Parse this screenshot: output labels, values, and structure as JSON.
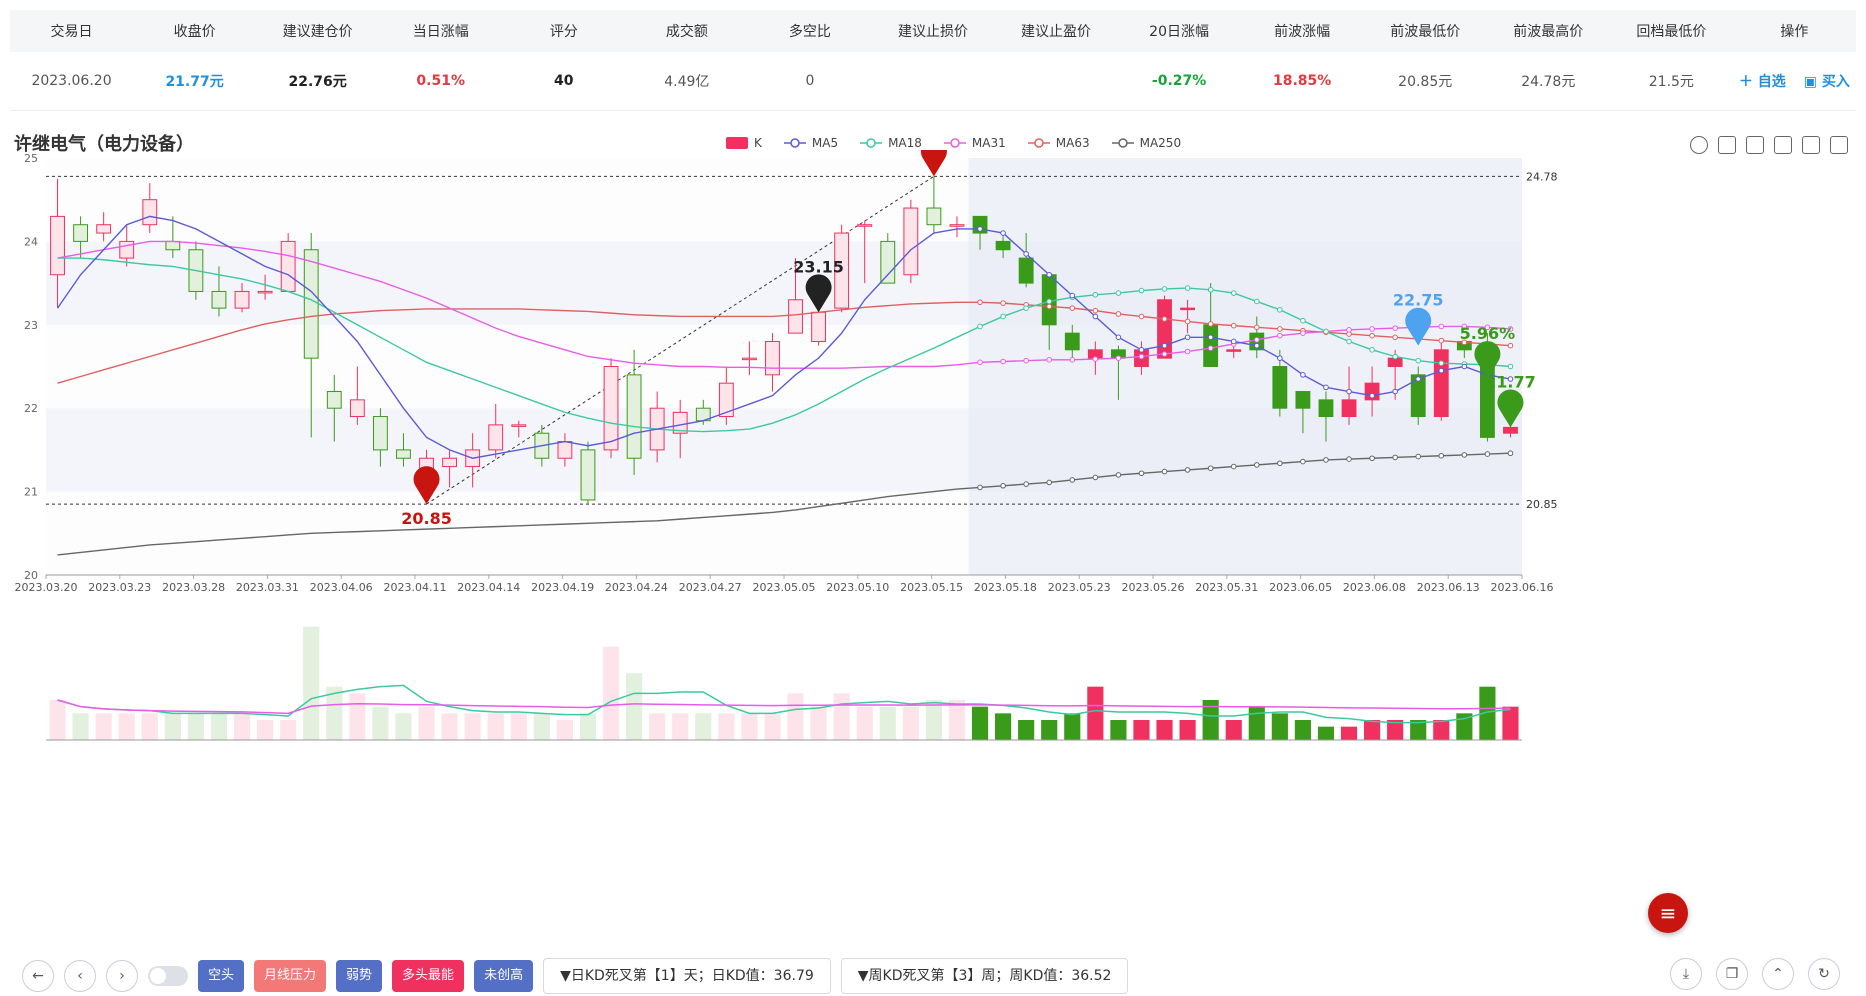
{
  "table": {
    "headers": [
      "交易日",
      "收盘价",
      "建议建仓价",
      "当日涨幅",
      "评分",
      "成交额",
      "多空比",
      "建议止损价",
      "建议止盈价",
      "20日涨幅",
      "前波涨幅",
      "前波最低价",
      "前波最高价",
      "回档最低价",
      "操作"
    ],
    "row": [
      "2023.06.20",
      "21.77元",
      "22.76元",
      "0.51%",
      "40",
      "4.49亿",
      "0",
      "",
      "",
      "-0.27%",
      "18.85%",
      "20.85元",
      "24.78元",
      "21.5元"
    ],
    "ops": {
      "watch": "＋ 自选",
      "buy": "▣ 买入"
    }
  },
  "stock_title": "许继电气（电力设备）",
  "legend": {
    "k": "K",
    "ma5": "MA5",
    "ma18": "MA18",
    "ma31": "MA31",
    "ma63": "MA63",
    "ma250": "MA250"
  },
  "colors": {
    "up": "#f0305e",
    "down": "#3a9a1a",
    "ma5": "#5b5bd6",
    "ma18": "#3bc9a1",
    "ma31": "#e85ce8",
    "ma63": "#e06060",
    "ma250": "#666666"
  },
  "bottom": {
    "tags": [
      "空头",
      "月线压力",
      "弱势",
      "多头最能",
      "未创高"
    ],
    "tag_colors": [
      "#5470c6",
      "#f37878",
      "#5470c6",
      "#f0305e",
      "#5470c6"
    ],
    "kd_daily": "▼日KD死叉第【1】天；日KD值：36.79",
    "kd_weekly": "▼周KD死叉第【3】周；周KD值：36.52"
  },
  "chart_data": {
    "type": "candlestick",
    "title": "许继电气（电力设备）",
    "y_ticks": [
      20,
      21,
      22,
      23,
      24,
      25
    ],
    "ylim": [
      20,
      25
    ],
    "x_tick_labels": [
      "2023.03.20",
      "2023.03.23",
      "2023.03.28",
      "2023.03.31",
      "2023.04.06",
      "2023.04.11",
      "2023.04.14",
      "2023.04.19",
      "2023.04.24",
      "2023.04.27",
      "2023.05.05",
      "2023.05.10",
      "2023.05.15",
      "2023.05.18",
      "2023.05.23",
      "2023.05.26",
      "2023.05.31",
      "2023.06.05",
      "2023.06.08",
      "2023.06.13",
      "2023.06.16"
    ],
    "reference_lines": [
      24.78,
      20.85
    ],
    "ohlc": [
      [
        23.6,
        24.3,
        23.2,
        24.75
      ],
      [
        24.2,
        24.0,
        23.8,
        24.3
      ],
      [
        24.1,
        24.2,
        24.0,
        24.35
      ],
      [
        23.8,
        24.0,
        23.7,
        24.2
      ],
      [
        24.2,
        24.5,
        24.1,
        24.7
      ],
      [
        24.0,
        23.9,
        23.8,
        24.3
      ],
      [
        23.9,
        23.4,
        23.3,
        24.0
      ],
      [
        23.4,
        23.2,
        23.1,
        23.7
      ],
      [
        23.2,
        23.4,
        23.15,
        23.5
      ],
      [
        23.4,
        23.4,
        23.3,
        23.6
      ],
      [
        23.4,
        24.0,
        23.4,
        24.1
      ],
      [
        23.9,
        22.6,
        21.65,
        24.1
      ],
      [
        22.2,
        22.0,
        21.6,
        22.4
      ],
      [
        21.9,
        22.1,
        21.8,
        22.5
      ],
      [
        21.9,
        21.5,
        21.3,
        22.0
      ],
      [
        21.5,
        21.4,
        21.3,
        21.7
      ],
      [
        21.2,
        21.4,
        20.85,
        21.5
      ],
      [
        21.3,
        21.4,
        21.05,
        21.5
      ],
      [
        21.3,
        21.5,
        21.05,
        21.7
      ],
      [
        21.5,
        21.8,
        21.4,
        22.05
      ],
      [
        21.8,
        21.8,
        21.65,
        21.85
      ],
      [
        21.7,
        21.4,
        21.3,
        21.8
      ],
      [
        21.4,
        21.6,
        21.3,
        21.7
      ],
      [
        21.5,
        20.9,
        20.85,
        21.6
      ],
      [
        21.5,
        22.5,
        21.4,
        22.6
      ],
      [
        22.4,
        21.4,
        21.2,
        22.7
      ],
      [
        21.5,
        22.0,
        21.35,
        22.2
      ],
      [
        21.7,
        21.95,
        21.4,
        22.1
      ],
      [
        22.0,
        21.85,
        21.8,
        22.1
      ],
      [
        21.9,
        22.3,
        21.8,
        22.5
      ],
      [
        22.6,
        22.6,
        22.4,
        22.8
      ],
      [
        22.4,
        22.8,
        22.2,
        22.9
      ],
      [
        22.9,
        23.3,
        22.9,
        23.8
      ],
      [
        22.8,
        23.15,
        22.75,
        23.2
      ],
      [
        23.2,
        24.1,
        23.15,
        24.2
      ],
      [
        24.2,
        24.2,
        23.5,
        24.25
      ],
      [
        24.0,
        23.5,
        23.5,
        24.1
      ],
      [
        23.6,
        24.4,
        23.5,
        24.5
      ],
      [
        24.4,
        24.2,
        24.1,
        24.78
      ],
      [
        24.2,
        24.2,
        24.05,
        24.3
      ],
      [
        24.3,
        24.1,
        23.9,
        24.3
      ],
      [
        24.0,
        23.9,
        23.8,
        24.1
      ],
      [
        23.8,
        23.5,
        23.45,
        24.1
      ],
      [
        23.6,
        23.0,
        22.7,
        23.6
      ],
      [
        22.9,
        22.7,
        22.6,
        23.0
      ],
      [
        22.6,
        22.7,
        22.4,
        22.8
      ],
      [
        22.7,
        22.6,
        22.1,
        22.75
      ],
      [
        22.5,
        22.7,
        22.4,
        22.8
      ],
      [
        22.6,
        23.3,
        22.6,
        23.35
      ],
      [
        23.2,
        23.2,
        22.9,
        23.3
      ],
      [
        23.0,
        22.5,
        22.5,
        23.5
      ],
      [
        22.7,
        22.7,
        22.6,
        22.8
      ],
      [
        22.9,
        22.7,
        22.6,
        23.1
      ],
      [
        22.5,
        22.0,
        21.9,
        22.7
      ],
      [
        22.2,
        22.0,
        21.7,
        22.2
      ],
      [
        22.1,
        21.9,
        21.6,
        22.2
      ],
      [
        21.9,
        22.1,
        21.8,
        22.5
      ],
      [
        22.1,
        22.3,
        21.9,
        22.5
      ],
      [
        22.5,
        22.6,
        22.1,
        22.7
      ],
      [
        22.4,
        21.9,
        21.8,
        22.5
      ],
      [
        21.9,
        22.7,
        21.85,
        22.8
      ],
      [
        22.8,
        22.7,
        22.6,
        22.8
      ],
      [
        22.7,
        21.65,
        21.6,
        22.9
      ],
      [
        21.7,
        21.77,
        21.65,
        21.8
      ]
    ],
    "ma5": [
      23.2,
      23.6,
      23.9,
      24.2,
      24.3,
      24.25,
      24.15,
      24.0,
      23.85,
      23.7,
      23.6,
      23.4,
      23.1,
      22.8,
      22.4,
      22.0,
      21.65,
      21.5,
      21.4,
      21.45,
      21.5,
      21.55,
      21.6,
      21.55,
      21.6,
      21.7,
      21.75,
      21.8,
      21.85,
      21.95,
      22.05,
      22.15,
      22.4,
      22.6,
      22.9,
      23.3,
      23.6,
      23.9,
      24.1,
      24.15,
      24.15,
      24.1,
      23.85,
      23.6,
      23.35,
      23.1,
      22.85,
      22.7,
      22.75,
      22.85,
      22.85,
      22.8,
      22.75,
      22.6,
      22.4,
      22.25,
      22.2,
      22.15,
      22.2,
      22.35,
      22.45,
      22.5,
      22.4,
      22.35
    ],
    "ma18": [
      23.8,
      23.8,
      23.78,
      23.75,
      23.72,
      23.7,
      23.65,
      23.6,
      23.55,
      23.48,
      23.4,
      23.3,
      23.15,
      23.0,
      22.85,
      22.7,
      22.55,
      22.45,
      22.35,
      22.25,
      22.15,
      22.05,
      21.95,
      21.88,
      21.82,
      21.78,
      21.75,
      21.73,
      21.72,
      21.73,
      21.75,
      21.82,
      21.92,
      22.05,
      22.2,
      22.35,
      22.48,
      22.6,
      22.72,
      22.85,
      22.98,
      23.1,
      23.2,
      23.28,
      23.33,
      23.36,
      23.38,
      23.41,
      23.43,
      23.44,
      23.42,
      23.38,
      23.28,
      23.18,
      23.05,
      22.92,
      22.8,
      22.7,
      22.62,
      22.57,
      22.54,
      22.53,
      22.52,
      22.5
    ],
    "ma31": [
      23.8,
      23.85,
      23.9,
      23.95,
      24.0,
      24.0,
      23.98,
      23.95,
      23.92,
      23.88,
      23.83,
      23.76,
      23.68,
      23.6,
      23.52,
      23.42,
      23.32,
      23.2,
      23.08,
      22.96,
      22.86,
      22.78,
      22.7,
      22.62,
      22.58,
      22.54,
      22.52,
      22.5,
      22.5,
      22.49,
      22.49,
      22.48,
      22.48,
      22.48,
      22.48,
      22.49,
      22.5,
      22.5,
      22.5,
      22.52,
      22.55,
      22.56,
      22.57,
      22.58,
      22.58,
      22.59,
      22.6,
      22.62,
      22.65,
      22.68,
      22.72,
      22.77,
      22.82,
      22.87,
      22.9,
      22.92,
      22.94,
      22.95,
      22.96,
      22.97,
      22.98,
      22.98,
      22.97,
      22.95
    ],
    "ma63": [
      22.3,
      22.38,
      22.46,
      22.54,
      22.62,
      22.7,
      22.78,
      22.86,
      22.94,
      23.01,
      23.06,
      23.1,
      23.13,
      23.15,
      23.17,
      23.18,
      23.19,
      23.19,
      23.19,
      23.19,
      23.19,
      23.18,
      23.17,
      23.16,
      23.14,
      23.12,
      23.11,
      23.1,
      23.1,
      23.1,
      23.1,
      23.1,
      23.12,
      23.15,
      23.18,
      23.21,
      23.23,
      23.25,
      23.26,
      23.27,
      23.27,
      23.26,
      23.24,
      23.22,
      23.2,
      23.17,
      23.13,
      23.1,
      23.07,
      23.04,
      23.01,
      22.99,
      22.97,
      22.95,
      22.93,
      22.91,
      22.89,
      22.87,
      22.85,
      22.83,
      22.81,
      22.79,
      22.77,
      22.75
    ],
    "ma250": [
      20.24,
      20.27,
      20.3,
      20.33,
      20.36,
      20.38,
      20.4,
      20.42,
      20.44,
      20.46,
      20.48,
      20.5,
      20.51,
      20.52,
      20.53,
      20.54,
      20.55,
      20.56,
      20.57,
      20.58,
      20.59,
      20.6,
      20.61,
      20.62,
      20.63,
      20.64,
      20.65,
      20.67,
      20.69,
      20.71,
      20.73,
      20.75,
      20.78,
      20.82,
      20.86,
      20.9,
      20.94,
      20.97,
      21.0,
      21.03,
      21.05,
      21.07,
      21.09,
      21.11,
      21.14,
      21.17,
      21.2,
      21.22,
      21.24,
      21.26,
      21.28,
      21.3,
      21.32,
      21.34,
      21.36,
      21.38,
      21.39,
      21.4,
      21.41,
      21.42,
      21.43,
      21.44,
      21.45,
      21.46
    ],
    "annotations": [
      {
        "label": "24.78",
        "value": 24.78,
        "color": "#c8150f"
      },
      {
        "label": "20.85",
        "value": 20.85,
        "color": "#c8150f"
      },
      {
        "label": "23.15",
        "value": 23.15,
        "color": "#222222"
      },
      {
        "label": "22.75",
        "value": 22.75,
        "color": "#4da3f0"
      },
      {
        "label": "21.77",
        "value": 21.77,
        "color": "#3a9a1a"
      },
      {
        "label": "5.96%",
        "value": 22.35,
        "color": "#3a9a1a"
      }
    ],
    "volume": [
      0.6,
      0.4,
      0.4,
      0.4,
      0.4,
      0.4,
      0.4,
      0.4,
      0.4,
      0.3,
      0.3,
      1.7,
      0.8,
      0.7,
      0.5,
      0.4,
      0.5,
      0.4,
      0.4,
      0.4,
      0.4,
      0.4,
      0.3,
      0.4,
      1.4,
      1.0,
      0.4,
      0.4,
      0.4,
      0.4,
      0.4,
      0.4,
      0.7,
      0.5,
      0.7,
      0.5,
      0.5,
      0.5,
      0.6,
      0.6,
      0.5,
      0.4,
      0.3,
      0.3,
      0.4,
      0.8,
      0.3,
      0.3,
      0.3,
      0.3,
      0.6,
      0.3,
      0.5,
      0.4,
      0.3,
      0.2,
      0.2,
      0.3,
      0.3,
      0.3,
      0.3,
      0.4,
      0.8,
      0.5
    ]
  }
}
